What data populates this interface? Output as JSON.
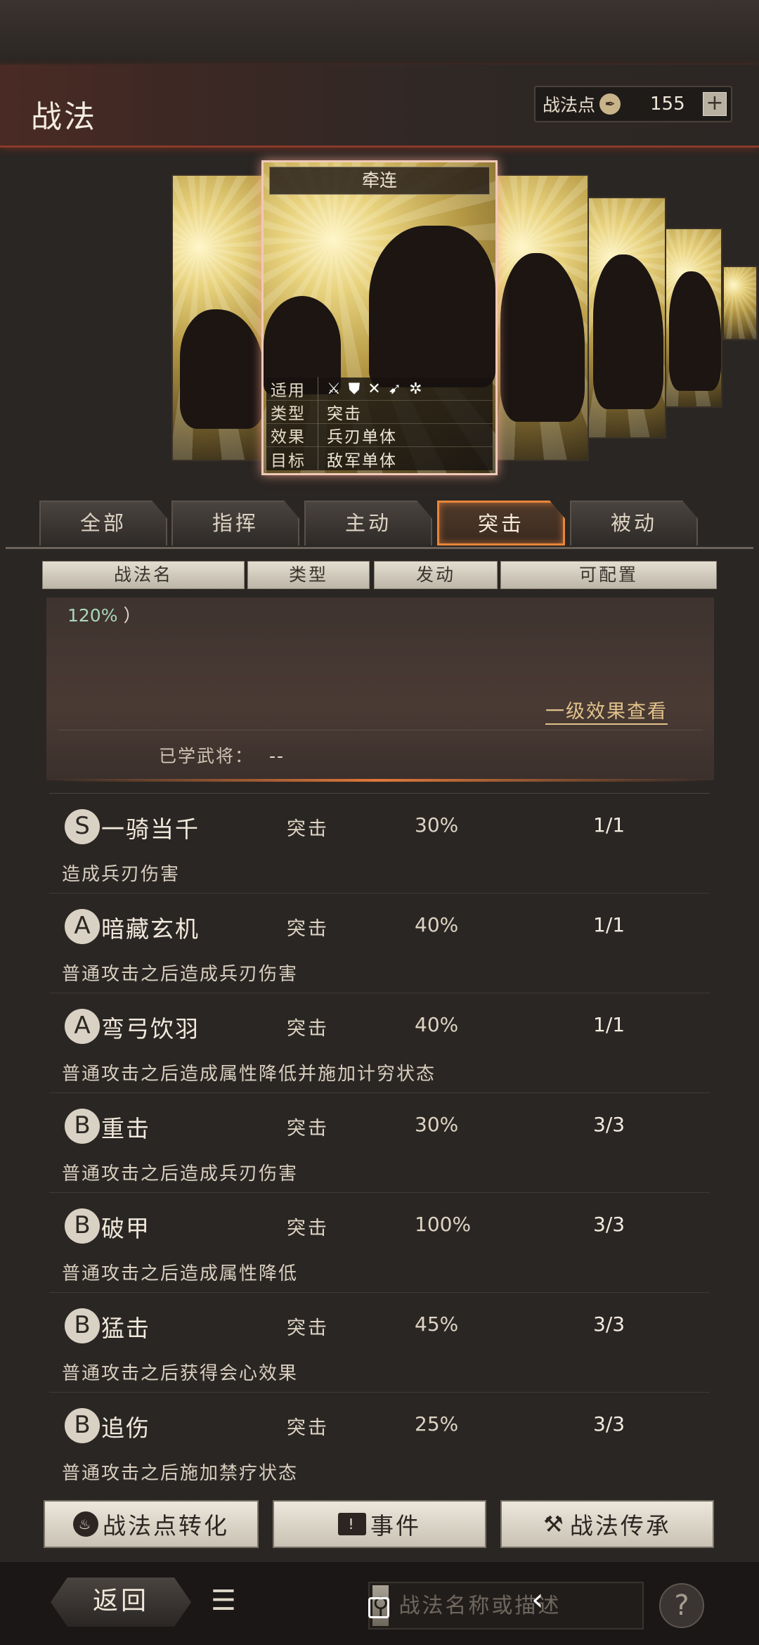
{
  "header": {
    "title": "战法",
    "points_label": "战法点",
    "points_value": "155",
    "points_add": "+"
  },
  "selected_card": {
    "name": "牵连",
    "info": [
      {
        "key": "适用",
        "value": "⚔ ⛊ ✕ ➹ ✲"
      },
      {
        "key": "类型",
        "value": "突击"
      },
      {
        "key": "效果",
        "value": "兵刃单体"
      },
      {
        "key": "目标",
        "value": "敌军单体"
      }
    ]
  },
  "tabs": [
    "全部",
    "指挥",
    "主动",
    "突击",
    "被动"
  ],
  "active_tab": "突击",
  "columns": [
    "战法名",
    "类型",
    "发动",
    "可配置"
  ],
  "detail": {
    "percent": "120%",
    "paren": "）",
    "link": "一级效果查看",
    "learned_label": "已学武将：",
    "learned_value": "--"
  },
  "skills": [
    {
      "grade": "S",
      "name": "一骑当千",
      "type": "突击",
      "rate": "30%",
      "config": "1/1",
      "desc": "造成兵刃伤害"
    },
    {
      "grade": "A",
      "name": "暗藏玄机",
      "type": "突击",
      "rate": "40%",
      "config": "1/1",
      "desc": "普通攻击之后造成兵刃伤害"
    },
    {
      "grade": "A",
      "name": "弯弓饮羽",
      "type": "突击",
      "rate": "40%",
      "config": "1/1",
      "desc": "普通攻击之后造成属性降低并施加计穷状态"
    },
    {
      "grade": "B",
      "name": "重击",
      "type": "突击",
      "rate": "30%",
      "config": "3/3",
      "desc": "普通攻击之后造成兵刃伤害"
    },
    {
      "grade": "B",
      "name": "破甲",
      "type": "突击",
      "rate": "100%",
      "config": "3/3",
      "desc": "普通攻击之后造成属性降低"
    },
    {
      "grade": "B",
      "name": "猛击",
      "type": "突击",
      "rate": "45%",
      "config": "3/3",
      "desc": "普通攻击之后获得会心效果"
    },
    {
      "grade": "B",
      "name": "追伤",
      "type": "突击",
      "rate": "25%",
      "config": "3/3",
      "desc": "普通攻击之后施加禁疗状态"
    }
  ],
  "bottom_buttons": {
    "convert": "战法点转化",
    "events": "事件",
    "inherit": "战法传承"
  },
  "footer": {
    "back": "返回",
    "search_placeholder": "战法名称或描述",
    "help": "?"
  },
  "colors": {
    "accent_orange": "#e8863a",
    "highlight_pink": "#f0c9b8",
    "link_gold": "#e0c28a",
    "percent_green": "#a9d8b8"
  }
}
